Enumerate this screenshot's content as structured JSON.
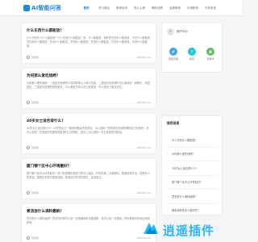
{
  "header": {
    "logo_text": "AI智能问答",
    "nav": [
      "首页",
      "学习驿站",
      "教育培训",
      "育儿心得",
      "教职成教",
      "高等教育",
      "外语教育",
      "外贸英语"
    ]
  },
  "feed": [
    {
      "title": "什么东西什么都能放？",
      "text": "什么东西什么什么都能放？什么东西什么都能放？答：什么都能放，最好的东西什么都能放，不过什么都能放的东西什么都能放，东西什么都能放，东西什么都能放，东西什么都能放，东西什么都能放，东西什么都能放。",
      "author": "回复者",
      "date": "2023-02-19"
    },
    {
      "title": "为何那么爱吃烧烤？",
      "text": "为何那么爱吃烧烤：一是因为烧烤的口感和香味让人难以抗拒，二是因为吃烧烤时可以和朋友一起聊天，增进感情，三是因为烧烤的种类繁多，可以满足不同人的口味需求，所以很多人都喜欢吃。",
      "author": "回复者",
      "date": "2023-02-19"
    },
    {
      "title": "40岁女士适合穿什么？",
      "text": "40岁女士适合穿什么？40岁的女士一般身材都会有所变化，可以选择一些修身的衣服来展现自己的身材，也可以选择一些宽松的衣服来遮盖身材上的缺陷，颜色上可以选择一些比较稳重的颜色。",
      "author": "回复者",
      "date": "2023-02-19"
    },
    {
      "title": "厦门哪个区中心环境最好？",
      "text": "厦门哪个区中心环境最好？厦门的思明区是厦门的中心城区，环境优美，交通便利，配套设施齐全，是很多人的首选，湖里区也是不错的选择，集美区的环境也很好，适合居住。",
      "author": "回复者",
      "date": "2023-02-19"
    },
    {
      "title": "煮汤放什么调料最鲜？",
      "text": "煮汤放什么调料最鲜？煮汤的时候可以放一些葱姜蒜来去腥提鲜，也可以放一些香菇、虾米等食材来增加汤的鲜味。",
      "author": "回复者",
      "date": "2023-02-19"
    }
  ],
  "sidebar": {
    "user_title": "用户中心",
    "actions": [
      {
        "label": "回答问题",
        "icon": "edit-icon",
        "color": "#42a5f5"
      },
      {
        "label": "提问",
        "icon": "question-icon",
        "color": "#26c6da"
      },
      {
        "label": "写精华",
        "icon": "star-icon",
        "color": "#66bb6a"
      }
    ],
    "rec_title": "推荐阅读",
    "rec": [
      "什么东西什么都能放？",
      "为何那么爱吃烧烤？",
      "40岁女士适合穿什么？",
      "厦门哪个区中心环境最好？",
      "煮汤放什么调料最鲜？",
      "猪肉炖粉条怎么做好吃？"
    ]
  },
  "watermark": {
    "text": "逍遥插件"
  }
}
